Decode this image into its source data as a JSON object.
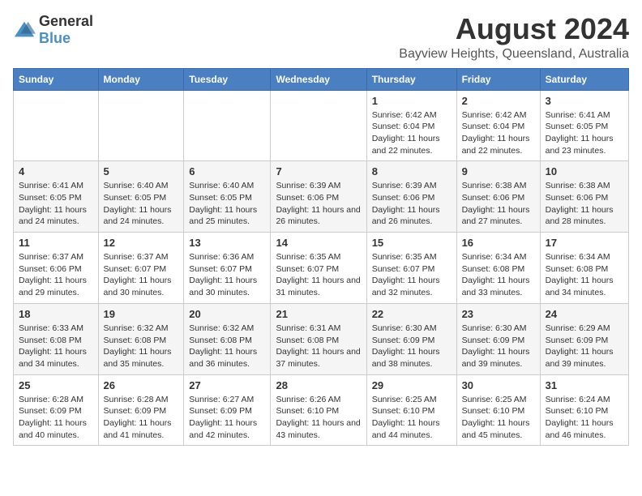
{
  "logo": {
    "general": "General",
    "blue": "Blue"
  },
  "title": "August 2024",
  "subtitle": "Bayview Heights, Queensland, Australia",
  "days_of_week": [
    "Sunday",
    "Monday",
    "Tuesday",
    "Wednesday",
    "Thursday",
    "Friday",
    "Saturday"
  ],
  "weeks": [
    [
      {
        "day": "",
        "sunrise": "",
        "sunset": "",
        "daylight": ""
      },
      {
        "day": "",
        "sunrise": "",
        "sunset": "",
        "daylight": ""
      },
      {
        "day": "",
        "sunrise": "",
        "sunset": "",
        "daylight": ""
      },
      {
        "day": "",
        "sunrise": "",
        "sunset": "",
        "daylight": ""
      },
      {
        "day": "1",
        "sunrise": "Sunrise: 6:42 AM",
        "sunset": "Sunset: 6:04 PM",
        "daylight": "Daylight: 11 hours and 22 minutes."
      },
      {
        "day": "2",
        "sunrise": "Sunrise: 6:42 AM",
        "sunset": "Sunset: 6:04 PM",
        "daylight": "Daylight: 11 hours and 22 minutes."
      },
      {
        "day": "3",
        "sunrise": "Sunrise: 6:41 AM",
        "sunset": "Sunset: 6:05 PM",
        "daylight": "Daylight: 11 hours and 23 minutes."
      }
    ],
    [
      {
        "day": "4",
        "sunrise": "Sunrise: 6:41 AM",
        "sunset": "Sunset: 6:05 PM",
        "daylight": "Daylight: 11 hours and 24 minutes."
      },
      {
        "day": "5",
        "sunrise": "Sunrise: 6:40 AM",
        "sunset": "Sunset: 6:05 PM",
        "daylight": "Daylight: 11 hours and 24 minutes."
      },
      {
        "day": "6",
        "sunrise": "Sunrise: 6:40 AM",
        "sunset": "Sunset: 6:05 PM",
        "daylight": "Daylight: 11 hours and 25 minutes."
      },
      {
        "day": "7",
        "sunrise": "Sunrise: 6:39 AM",
        "sunset": "Sunset: 6:06 PM",
        "daylight": "Daylight: 11 hours and 26 minutes."
      },
      {
        "day": "8",
        "sunrise": "Sunrise: 6:39 AM",
        "sunset": "Sunset: 6:06 PM",
        "daylight": "Daylight: 11 hours and 26 minutes."
      },
      {
        "day": "9",
        "sunrise": "Sunrise: 6:38 AM",
        "sunset": "Sunset: 6:06 PM",
        "daylight": "Daylight: 11 hours and 27 minutes."
      },
      {
        "day": "10",
        "sunrise": "Sunrise: 6:38 AM",
        "sunset": "Sunset: 6:06 PM",
        "daylight": "Daylight: 11 hours and 28 minutes."
      }
    ],
    [
      {
        "day": "11",
        "sunrise": "Sunrise: 6:37 AM",
        "sunset": "Sunset: 6:06 PM",
        "daylight": "Daylight: 11 hours and 29 minutes."
      },
      {
        "day": "12",
        "sunrise": "Sunrise: 6:37 AM",
        "sunset": "Sunset: 6:07 PM",
        "daylight": "Daylight: 11 hours and 30 minutes."
      },
      {
        "day": "13",
        "sunrise": "Sunrise: 6:36 AM",
        "sunset": "Sunset: 6:07 PM",
        "daylight": "Daylight: 11 hours and 30 minutes."
      },
      {
        "day": "14",
        "sunrise": "Sunrise: 6:35 AM",
        "sunset": "Sunset: 6:07 PM",
        "daylight": "Daylight: 11 hours and 31 minutes."
      },
      {
        "day": "15",
        "sunrise": "Sunrise: 6:35 AM",
        "sunset": "Sunset: 6:07 PM",
        "daylight": "Daylight: 11 hours and 32 minutes."
      },
      {
        "day": "16",
        "sunrise": "Sunrise: 6:34 AM",
        "sunset": "Sunset: 6:08 PM",
        "daylight": "Daylight: 11 hours and 33 minutes."
      },
      {
        "day": "17",
        "sunrise": "Sunrise: 6:34 AM",
        "sunset": "Sunset: 6:08 PM",
        "daylight": "Daylight: 11 hours and 34 minutes."
      }
    ],
    [
      {
        "day": "18",
        "sunrise": "Sunrise: 6:33 AM",
        "sunset": "Sunset: 6:08 PM",
        "daylight": "Daylight: 11 hours and 34 minutes."
      },
      {
        "day": "19",
        "sunrise": "Sunrise: 6:32 AM",
        "sunset": "Sunset: 6:08 PM",
        "daylight": "Daylight: 11 hours and 35 minutes."
      },
      {
        "day": "20",
        "sunrise": "Sunrise: 6:32 AM",
        "sunset": "Sunset: 6:08 PM",
        "daylight": "Daylight: 11 hours and 36 minutes."
      },
      {
        "day": "21",
        "sunrise": "Sunrise: 6:31 AM",
        "sunset": "Sunset: 6:08 PM",
        "daylight": "Daylight: 11 hours and 37 minutes."
      },
      {
        "day": "22",
        "sunrise": "Sunrise: 6:30 AM",
        "sunset": "Sunset: 6:09 PM",
        "daylight": "Daylight: 11 hours and 38 minutes."
      },
      {
        "day": "23",
        "sunrise": "Sunrise: 6:30 AM",
        "sunset": "Sunset: 6:09 PM",
        "daylight": "Daylight: 11 hours and 39 minutes."
      },
      {
        "day": "24",
        "sunrise": "Sunrise: 6:29 AM",
        "sunset": "Sunset: 6:09 PM",
        "daylight": "Daylight: 11 hours and 39 minutes."
      }
    ],
    [
      {
        "day": "25",
        "sunrise": "Sunrise: 6:28 AM",
        "sunset": "Sunset: 6:09 PM",
        "daylight": "Daylight: 11 hours and 40 minutes."
      },
      {
        "day": "26",
        "sunrise": "Sunrise: 6:28 AM",
        "sunset": "Sunset: 6:09 PM",
        "daylight": "Daylight: 11 hours and 41 minutes."
      },
      {
        "day": "27",
        "sunrise": "Sunrise: 6:27 AM",
        "sunset": "Sunset: 6:09 PM",
        "daylight": "Daylight: 11 hours and 42 minutes."
      },
      {
        "day": "28",
        "sunrise": "Sunrise: 6:26 AM",
        "sunset": "Sunset: 6:10 PM",
        "daylight": "Daylight: 11 hours and 43 minutes."
      },
      {
        "day": "29",
        "sunrise": "Sunrise: 6:25 AM",
        "sunset": "Sunset: 6:10 PM",
        "daylight": "Daylight: 11 hours and 44 minutes."
      },
      {
        "day": "30",
        "sunrise": "Sunrise: 6:25 AM",
        "sunset": "Sunset: 6:10 PM",
        "daylight": "Daylight: 11 hours and 45 minutes."
      },
      {
        "day": "31",
        "sunrise": "Sunrise: 6:24 AM",
        "sunset": "Sunset: 6:10 PM",
        "daylight": "Daylight: 11 hours and 46 minutes."
      }
    ]
  ]
}
